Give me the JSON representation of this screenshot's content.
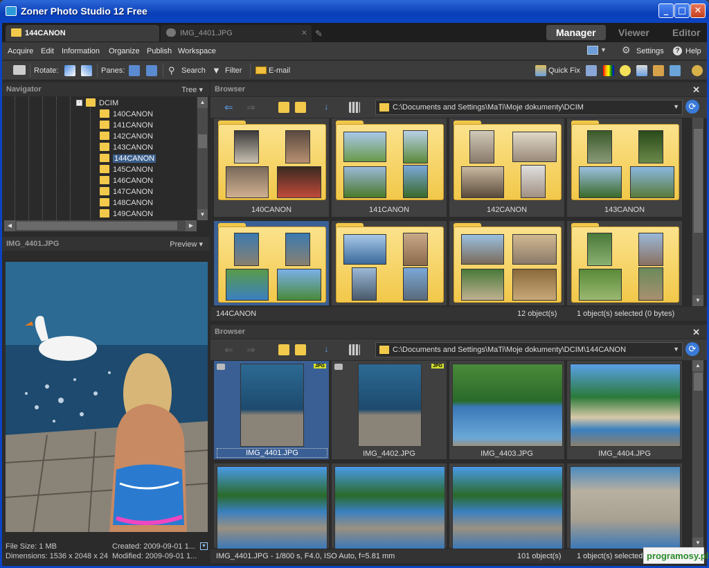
{
  "window": {
    "title": "Zoner Photo Studio 12 Free"
  },
  "tabs": [
    {
      "label": "144CANON",
      "active": true
    },
    {
      "label": "IMG_4401.JPG",
      "active": false
    }
  ],
  "modes": [
    {
      "label": "Manager",
      "active": true
    },
    {
      "label": "Viewer",
      "active": false
    },
    {
      "label": "Editor",
      "active": false
    }
  ],
  "menu": {
    "items": [
      "Acquire",
      "Edit",
      "Information",
      "Organize",
      "Publish",
      "Workspace"
    ],
    "settings": "Settings",
    "help": "Help"
  },
  "toolbar": {
    "rotate": "Rotate:",
    "panes": "Panes:",
    "search": "Search",
    "filter": "Filter",
    "email": "E-mail",
    "quickfix": "Quick Fix"
  },
  "navigator": {
    "title": "Navigator",
    "mode": "Tree",
    "root": "DCIM",
    "folders": [
      "140CANON",
      "141CANON",
      "142CANON",
      "143CANON",
      "144CANON",
      "145CANON",
      "146CANON",
      "147CANON",
      "148CANON",
      "149CANON"
    ],
    "selected": "144CANON"
  },
  "preview": {
    "filename": "IMG_4401.JPG",
    "mode": "Preview",
    "file_size": "File Size: 1 MB",
    "dimensions": "Dimensions: 1536 x 2048 x 24",
    "created": "Created: 2009-09-01 1...",
    "modified": "Modified: 2009-09-01 1..."
  },
  "browser_top": {
    "title": "Browser",
    "path": "C:\\Documents and Settings\\MaTi\\Moje dokumenty\\DCIM",
    "folders": [
      "140CANON",
      "141CANON",
      "142CANON",
      "143CANON",
      "144CANON",
      "",
      "",
      ""
    ],
    "status_left": "144CANON",
    "status_count": "12 object(s)",
    "status_sel": "1 object(s) selected (0 bytes)"
  },
  "browser_bottom": {
    "title": "Browser",
    "path": "C:\\Documents and Settings\\MaTi\\Moje dokumenty\\DCIM\\144CANON",
    "files": [
      "IMG_4401.JPG",
      "IMG_4402.JPG",
      "IMG_4403.JPG",
      "IMG_4404.JPG",
      "",
      "",
      "",
      ""
    ],
    "badge": "JPG",
    "status_left": "IMG_4401.JPG - 1/800 s, F4.0, ISO Auto, f=5.81 mm",
    "status_count": "101 object(s)",
    "status_sel": "1 object(s) selected"
  },
  "watermark": "programosy.pl"
}
